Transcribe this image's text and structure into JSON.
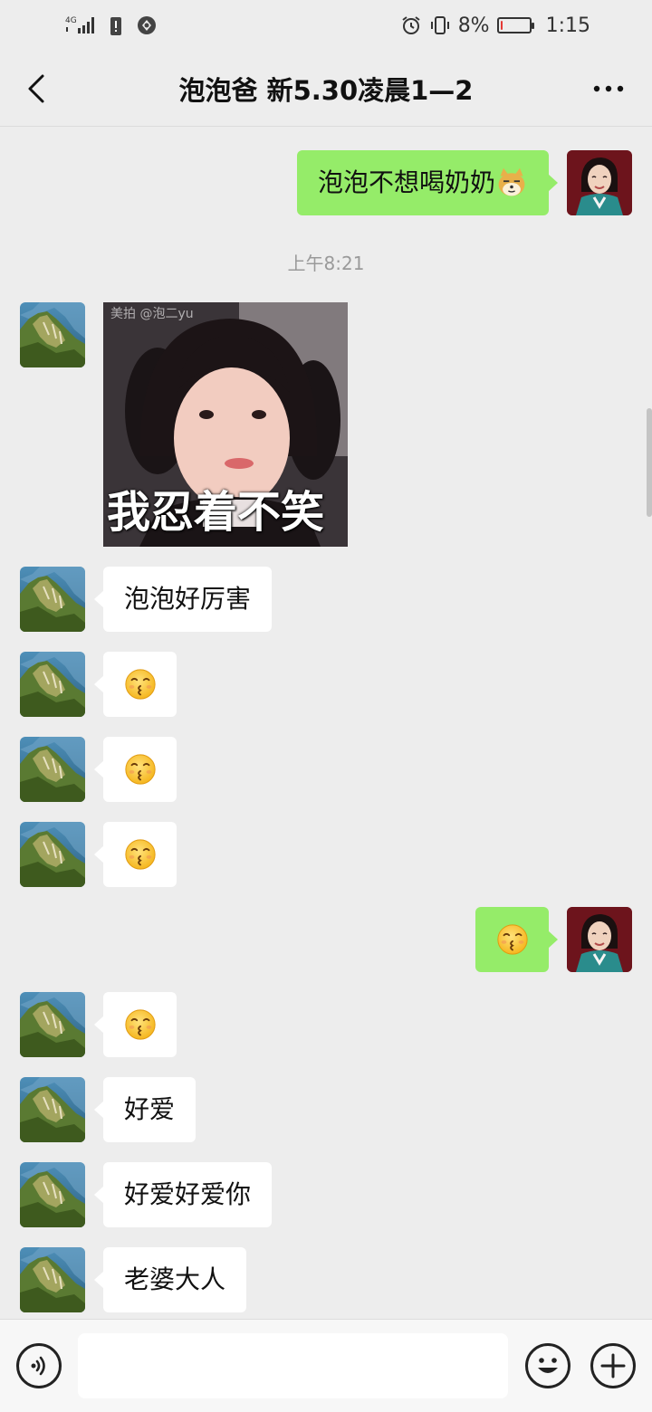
{
  "status_bar": {
    "network": "4G",
    "battery_percent": "8%",
    "battery_level": 0.08,
    "time": "1:15"
  },
  "header": {
    "title": "泡泡爸 新5.30凌晨1—2",
    "back_icon": "chevron-left-icon",
    "more_icon": "more-dots-icon"
  },
  "colors": {
    "background": "#ededed",
    "incoming_bubble": "#ffffff",
    "outgoing_bubble": "#95ec69",
    "timestamp": "#9a9a9a"
  },
  "chat": {
    "timestamp": "上午8:21",
    "messages": [
      {
        "direction": "out",
        "text": "泡泡不想喝奶奶",
        "emoji": "doge"
      },
      {
        "direction": "in",
        "type": "sticker",
        "caption": "我忍着不笑",
        "watermark": "美拍 @泡二yu"
      },
      {
        "direction": "in",
        "text": "泡泡好厉害"
      },
      {
        "direction": "in",
        "type": "emoji",
        "emoji": "kiss-face"
      },
      {
        "direction": "in",
        "type": "emoji",
        "emoji": "kiss-face"
      },
      {
        "direction": "in",
        "type": "emoji",
        "emoji": "kiss-face"
      },
      {
        "direction": "out",
        "type": "emoji",
        "emoji": "kiss-face"
      },
      {
        "direction": "in",
        "type": "emoji",
        "emoji": "kiss-face"
      },
      {
        "direction": "in",
        "text": "好爱"
      },
      {
        "direction": "in",
        "text": "好爱好爱你"
      },
      {
        "direction": "in",
        "text": "老婆大人"
      }
    ]
  },
  "input_bar": {
    "value": "",
    "voice_icon": "voice-icon",
    "emoji_icon": "smiley-icon",
    "plus_icon": "plus-icon"
  }
}
